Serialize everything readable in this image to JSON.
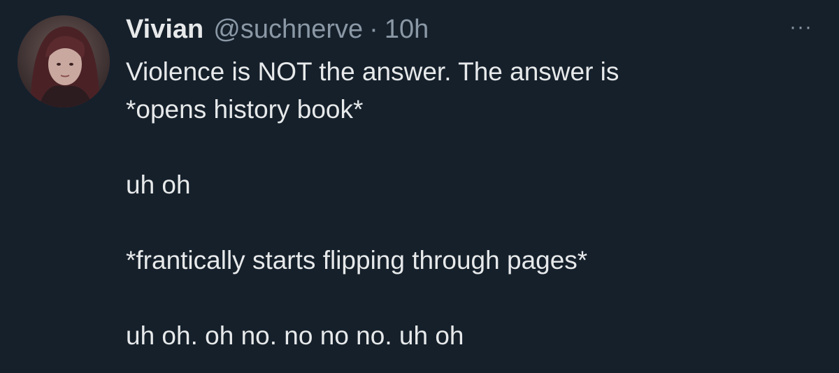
{
  "tweet": {
    "author": {
      "display_name": "Vivian",
      "handle": "@suchnerve",
      "separator": "·",
      "time": "10h"
    },
    "more_icon": "more-horizontal-icon",
    "more_label": "···",
    "text_lines": [
      "Violence is NOT the answer. The answer is",
      "*opens history book*",
      "",
      "uh oh",
      "",
      "*frantically starts flipping through pages*",
      "",
      "uh oh. oh no. no no no. uh oh"
    ]
  },
  "colors": {
    "background": "#15202b",
    "primary_text": "#e7e9ea",
    "secondary_text": "#8b98a5"
  }
}
